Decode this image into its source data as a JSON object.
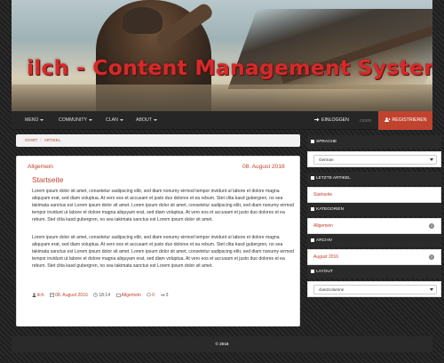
{
  "banner": {
    "title": "ilch - Content Management System"
  },
  "nav": {
    "items": [
      "MENÜ",
      "COMMUNITY",
      "CLAN",
      "ABOUT"
    ],
    "login": "EINLOGGEN",
    "oder": "ODER",
    "register": "REGISTRIEREN"
  },
  "breadcrumb": {
    "start": "START",
    "article": "ARTIKEL"
  },
  "post": {
    "category": "Allgemein",
    "date": "08. August 2016",
    "title": "Startseite",
    "paragraphs": [
      "Lorem ipsum dolor sit amet, consetetur sadipscing elitr, sed diam nonumy eirmod tempor invidunt ut labore et dolore magna aliquyam erat, sed diam voluptua. At vero eos et accusam et justo duo dolores et ea rebum. Stet clita kasd gubergren, no sea takimata sanctus est Lorem ipsum dolor sit amet. Lorem ipsum dolor sit amet, consetetur sadipscing elitr, sed diam nonumy eirmod tempor invidunt ut labore et dolore magna aliquyam erat, sed diam voluptua. At vero eos et accusam et justo duo dolores et ea rebum. Stet clita kasd gubergren, no sea takimata sanctus est Lorem ipsum dolor sit amet.",
      "Lorem ipsum dolor sit amet, consetetur sadipscing elitr, sed diam nonumy eirmod tempor invidunt ut labore et dolore magna aliquyam erat, sed diam voluptua. At vero eos et accusam et justo duo dolores et ea rebum. Stet clita kasd gubergren, no sea takimata sanctus est Lorem ipsum dolor sit amet. Lorem ipsum dolor sit amet, consetetur sadipscing elitr, sed diam nonumy eirmod tempor invidunt ut labore et dolore magna aliquyam erat, sed diam voluptua. At vero eos et accusam et justo duo dolores et ea rebum. Stet clita kasd gubergren, no sea takimata sanctus est Lorem ipsum dolor sit amet."
    ],
    "meta": {
      "author": "ilch",
      "date": "08. August 2016",
      "time": "18:14",
      "category": "Allgemein",
      "comments": "0",
      "views": "3"
    }
  },
  "sidebar": {
    "sprache": {
      "title": "SPRACHE",
      "value": "German"
    },
    "letzte": {
      "title": "LETZTE ARTIKEL",
      "link": "Startseite"
    },
    "kategorien": {
      "title": "KATEGORIEN",
      "link": "Allgemein",
      "count": "1"
    },
    "archiv": {
      "title": "ARCHIV",
      "link": "August 2016",
      "count": "1"
    },
    "layout": {
      "title": "LAYOUT",
      "value": "clan2columns"
    }
  },
  "footer": {
    "text": "© 2016"
  },
  "colors": {
    "accent": "#c0432f",
    "dark": "#2a2a2a",
    "title_red": "#d52a2a"
  }
}
